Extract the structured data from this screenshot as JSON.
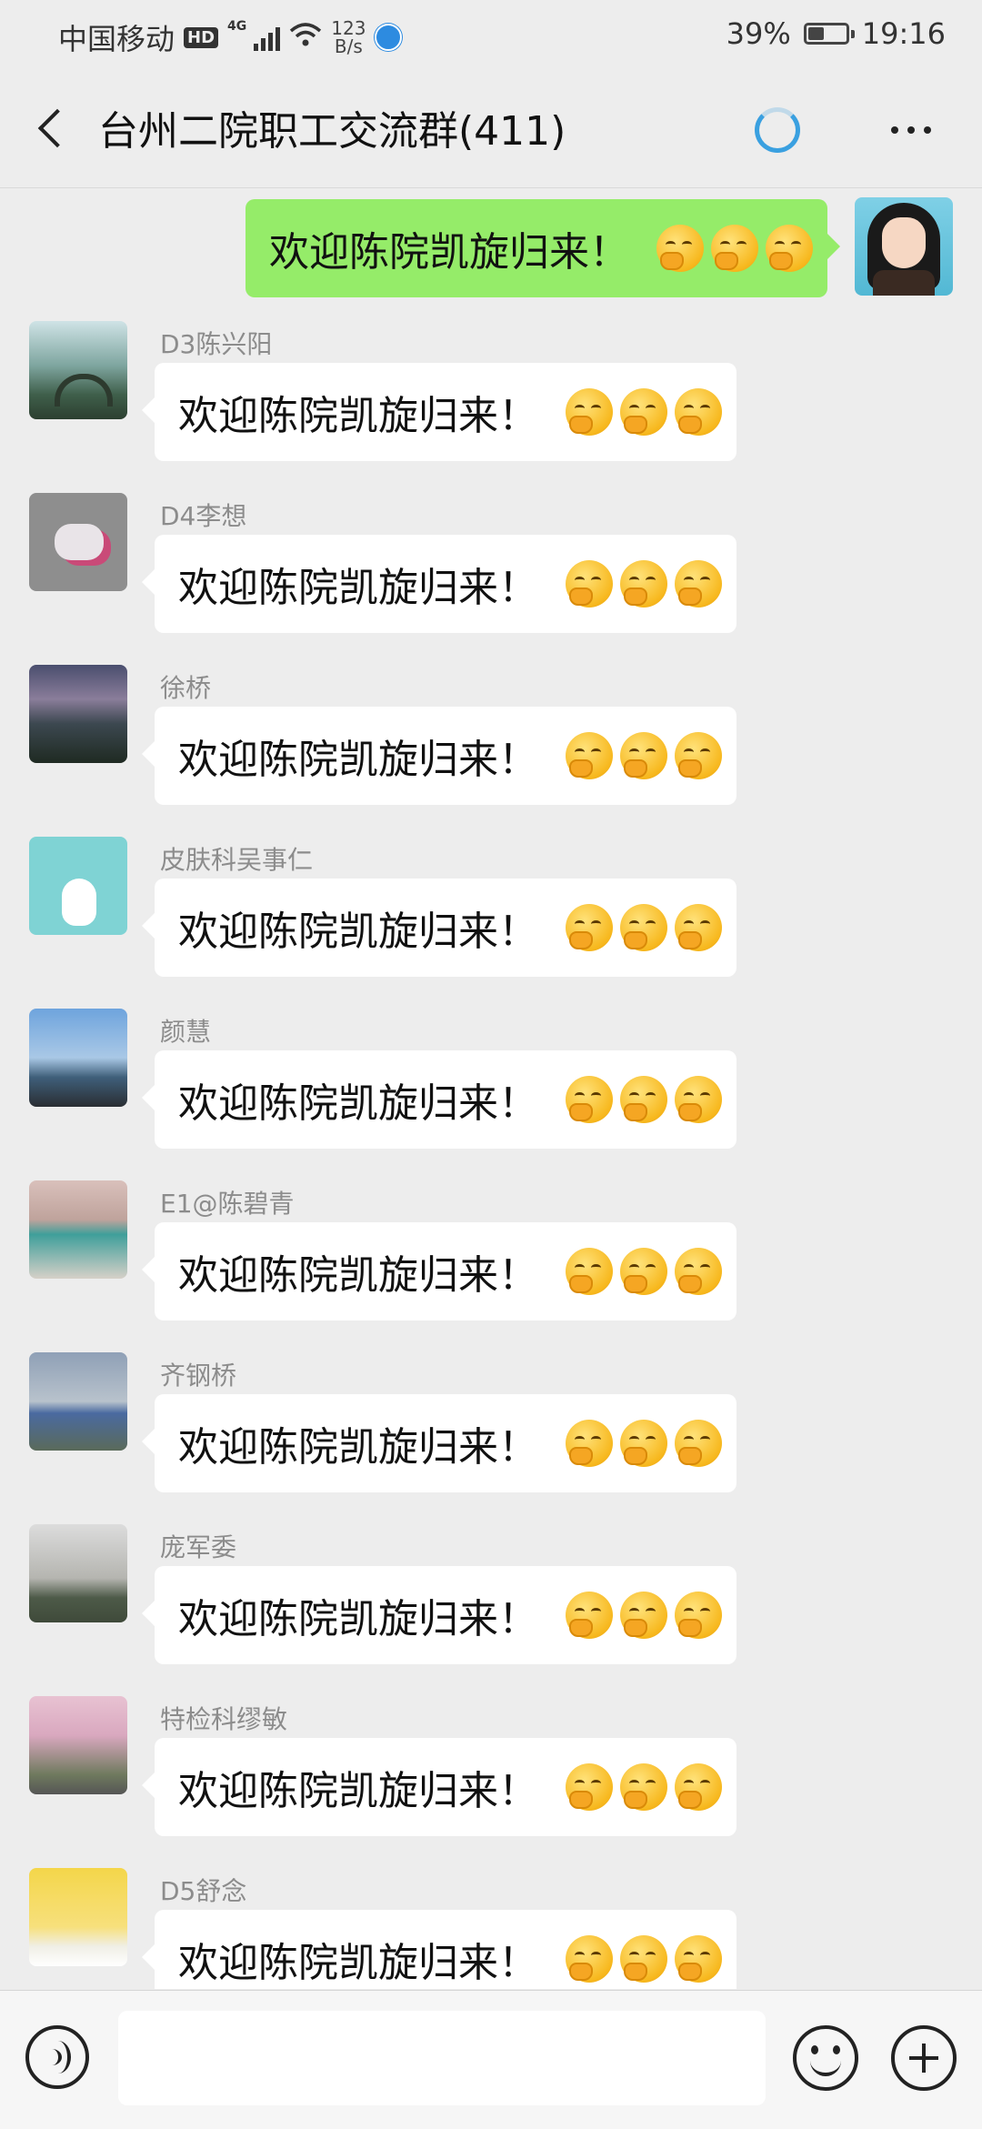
{
  "status_bar": {
    "carrier": "中国移动",
    "hd_badge": "HD",
    "network_label": "4G",
    "speed_value": "123",
    "speed_unit": "B/s",
    "battery_percent": "39%",
    "battery_level": 0.39,
    "time": "19:16"
  },
  "header": {
    "title": "台州二院职工交流群(411)",
    "back_icon": "chevron-left-icon",
    "spinner_icon": "loading-spinner-icon",
    "more_icon": "more-dots-icon"
  },
  "colors": {
    "outgoing_bubble": "#95ec69",
    "incoming_bubble": "#ffffff",
    "background": "#ededed"
  },
  "messages": [
    {
      "direction": "outgoing",
      "sender": "",
      "text": "欢迎陈院凯旋归来！",
      "emoji": "yawning-face-emoji",
      "emoji_count": 3
    },
    {
      "direction": "incoming",
      "sender": "D3陈兴阳",
      "text": "欢迎陈院凯旋归来！",
      "emoji": "yawning-face-emoji",
      "emoji_count": 3
    },
    {
      "direction": "incoming",
      "sender": "D4李想",
      "text": "欢迎陈院凯旋归来！",
      "emoji": "yawning-face-emoji",
      "emoji_count": 3
    },
    {
      "direction": "incoming",
      "sender": "徐桥",
      "text": "欢迎陈院凯旋归来！",
      "emoji": "yawning-face-emoji",
      "emoji_count": 3
    },
    {
      "direction": "incoming",
      "sender": "皮肤科吴事仁",
      "text": "欢迎陈院凯旋归来！",
      "emoji": "yawning-face-emoji",
      "emoji_count": 3
    },
    {
      "direction": "incoming",
      "sender": "颜慧",
      "text": "欢迎陈院凯旋归来！",
      "emoji": "yawning-face-emoji",
      "emoji_count": 3
    },
    {
      "direction": "incoming",
      "sender": "E1@陈碧青",
      "text": "欢迎陈院凯旋归来！",
      "emoji": "yawning-face-emoji",
      "emoji_count": 3
    },
    {
      "direction": "incoming",
      "sender": "齐钢桥",
      "text": "欢迎陈院凯旋归来！",
      "emoji": "yawning-face-emoji",
      "emoji_count": 3
    },
    {
      "direction": "incoming",
      "sender": "庞军委",
      "text": "欢迎陈院凯旋归来！",
      "emoji": "yawning-face-emoji",
      "emoji_count": 3
    },
    {
      "direction": "incoming",
      "sender": "特检科缪敏",
      "text": "欢迎陈院凯旋归来！",
      "emoji": "yawning-face-emoji",
      "emoji_count": 3
    },
    {
      "direction": "incoming",
      "sender": "D5舒念",
      "text": "欢迎陈院凯旋归来！",
      "emoji": "yawning-face-emoji",
      "emoji_count": 3
    }
  ],
  "input_bar": {
    "voice_icon": "voice-input-icon",
    "input_value": "",
    "emoji_icon": "emoji-smile-icon",
    "plus_icon": "plus-circle-icon"
  }
}
